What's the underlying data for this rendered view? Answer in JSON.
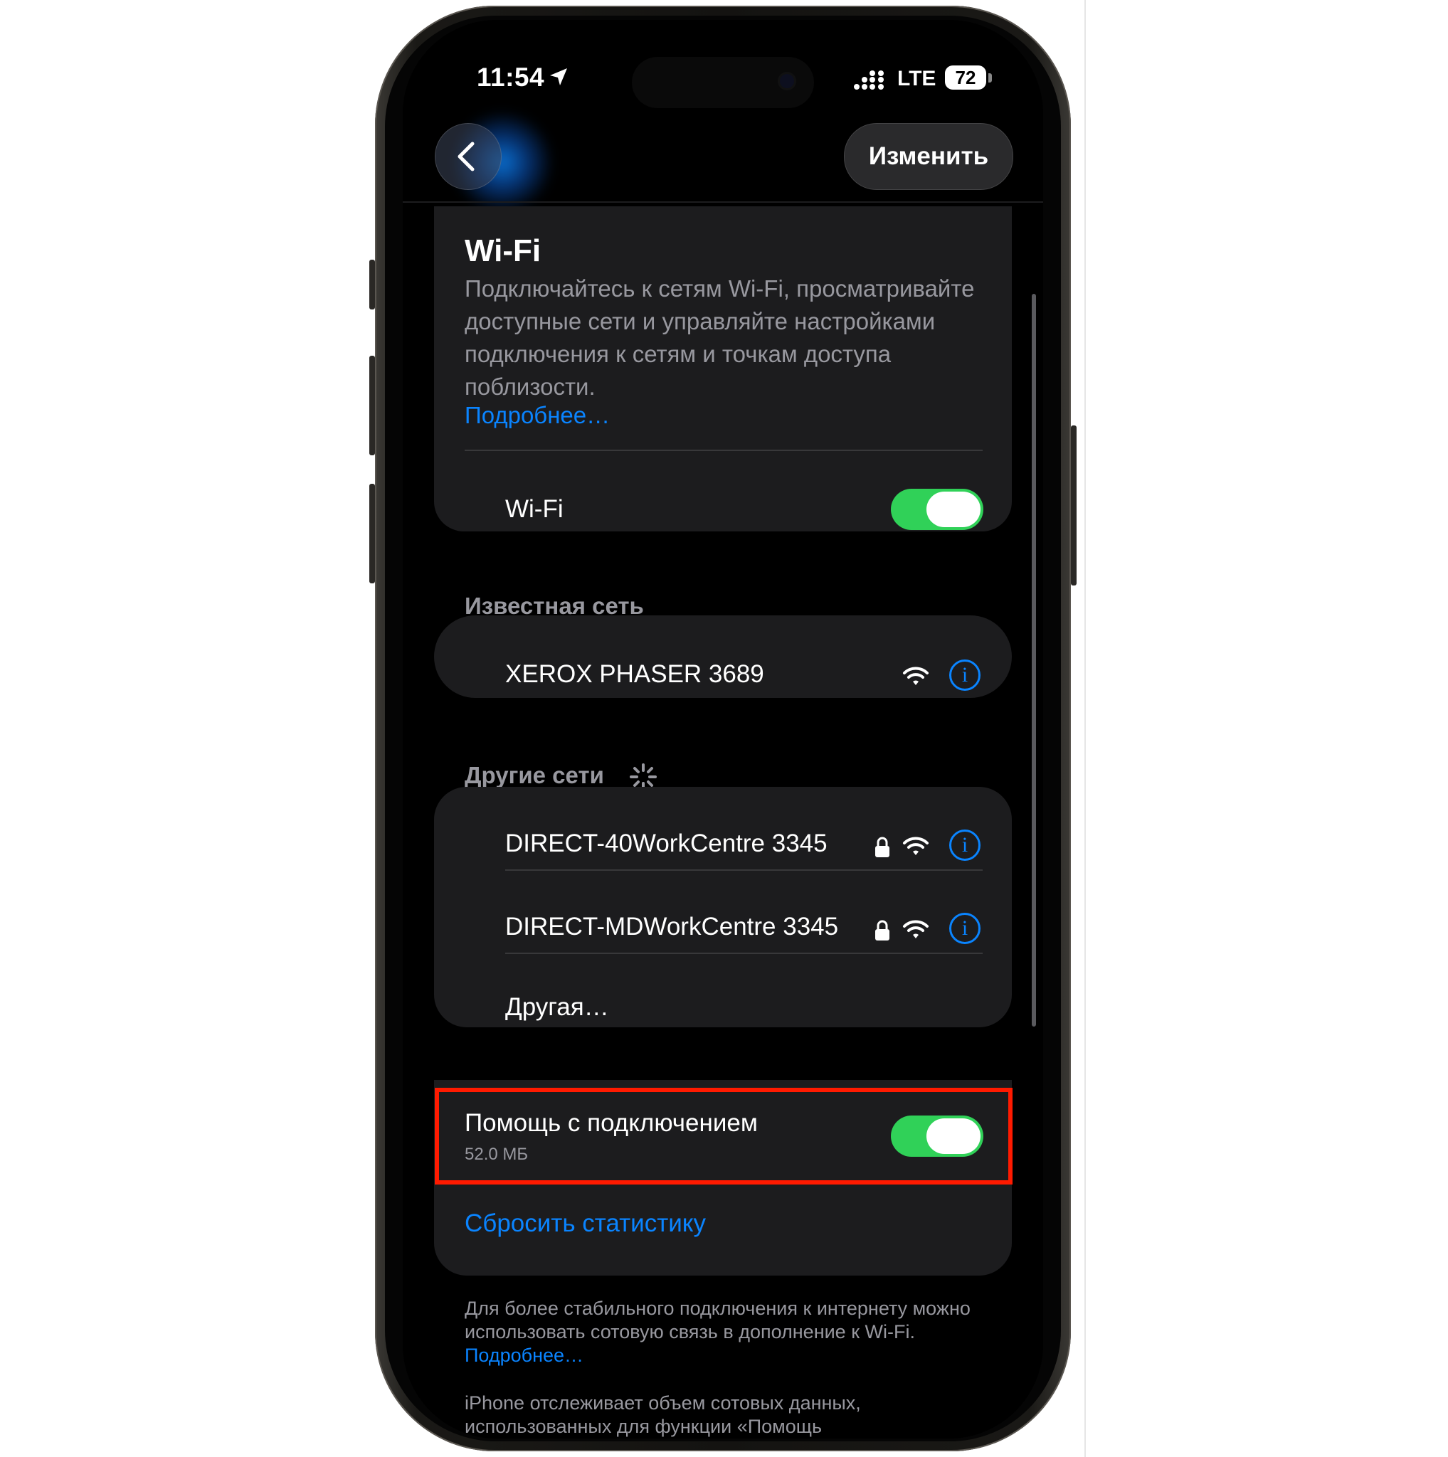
{
  "status_bar": {
    "time": "11:54",
    "network": "LTE",
    "battery": "72"
  },
  "nav": {
    "edit_label": "Изменить"
  },
  "wifi_card": {
    "title": "Wi-Fi",
    "description": "Подключайтесь к сетям Wi-Fi, просматривайте доступные сети и управляйте настройками подключения к сетям и точкам доступа поблизости.",
    "learn_more": "Подробнее…",
    "toggle_label": "Wi-Fi",
    "toggle_on": true
  },
  "known_networks": {
    "header": "Известная сеть",
    "items": [
      {
        "name": "XEROX PHASER 3689"
      }
    ]
  },
  "other_networks": {
    "header": "Другие сети",
    "items": [
      {
        "name": "DIRECT-40WorkCentre 3345",
        "locked": true
      },
      {
        "name": "DIRECT-MDWorkCentre 3345",
        "locked": true
      }
    ],
    "other_label": "Другая…"
  },
  "assist": {
    "title": "Помощь с подключением",
    "usage": "52.0 МБ",
    "toggle_on": true,
    "reset_label": "Сбросить статистику"
  },
  "footer": {
    "text1": "Для более стабильного подключения к интернету можно использовать сотовую связь в дополнение к Wi-Fi.",
    "link1": "Подробнее…",
    "text2": "iPhone отслеживает объем сотовых данных, использованных для функции «Помощь"
  },
  "colors": {
    "accent": "#0a84ff",
    "toggle_on": "#30d158",
    "highlight": "#ff1a00",
    "card": "#1c1c1e"
  }
}
